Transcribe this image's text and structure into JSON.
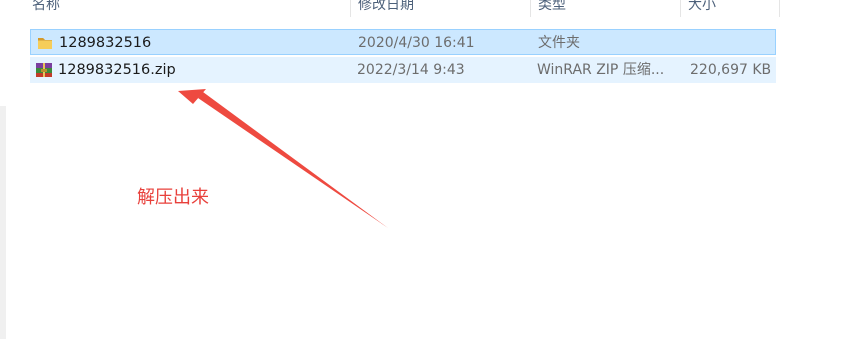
{
  "columns": {
    "name": "名称",
    "modified": "修改日期",
    "type": "类型",
    "size": "大小"
  },
  "files": [
    {
      "name": "1289832516",
      "modified": "2020/4/30 16:41",
      "type": "文件夹",
      "size": "",
      "icon": "folder-icon"
    },
    {
      "name": "1289832516.zip",
      "modified": "2022/3/14 9:43",
      "type": "WinRAR ZIP 压缩...",
      "size": "220,697 KB",
      "icon": "winrar-archive-icon"
    }
  ],
  "annotation": {
    "text": "解压出来",
    "color": "#e8403b"
  },
  "colors": {
    "selected_bg": "#cce8ff",
    "selected_border": "#99d1ff",
    "hover_bg": "#e5f3ff",
    "header_text": "#4c607a"
  }
}
